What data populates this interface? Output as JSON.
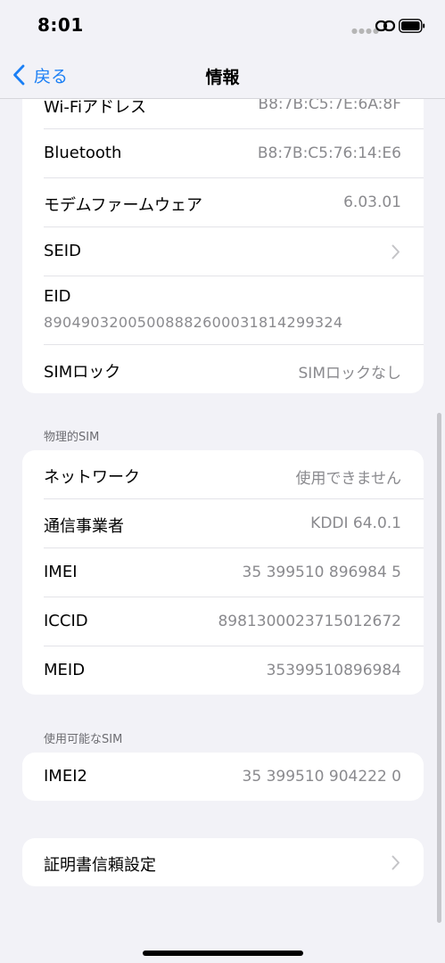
{
  "status_bar": {
    "time": "8:01"
  },
  "nav": {
    "back_label": "戻る",
    "title": "情報"
  },
  "group1": {
    "rows": [
      {
        "label": "Wi-Fiアドレス",
        "value": "B8:7B:C5:7E:6A:8F"
      },
      {
        "label": "Bluetooth",
        "value": "B8:7B:C5:76:14:E6"
      },
      {
        "label": "モデムファームウェア",
        "value": "6.03.01"
      },
      {
        "label": "SEID"
      },
      {
        "label": "EID",
        "value": "89049032005008882600031814299324"
      },
      {
        "label": "SIMロック",
        "value": "SIMロックなし"
      }
    ]
  },
  "physical_sim": {
    "header": "物理的SIM",
    "rows": [
      {
        "label": "ネットワーク",
        "value": "使用できません"
      },
      {
        "label": "通信事業者",
        "value": "KDDI 64.0.1"
      },
      {
        "label": "IMEI",
        "value": "35 399510 896984 5"
      },
      {
        "label": "ICCID",
        "value": "8981300023715012672"
      },
      {
        "label": "MEID",
        "value": "35399510896984"
      }
    ]
  },
  "available_sim": {
    "header": "使用可能なSIM",
    "rows": [
      {
        "label": "IMEI2",
        "value": "35 399510 904222 0"
      }
    ]
  },
  "certificate": {
    "label": "証明書信頼設定"
  },
  "colors": {
    "accent": "#1a7ff5",
    "background": "#f2f2f7",
    "secondary_text": "#8a8a8e"
  }
}
